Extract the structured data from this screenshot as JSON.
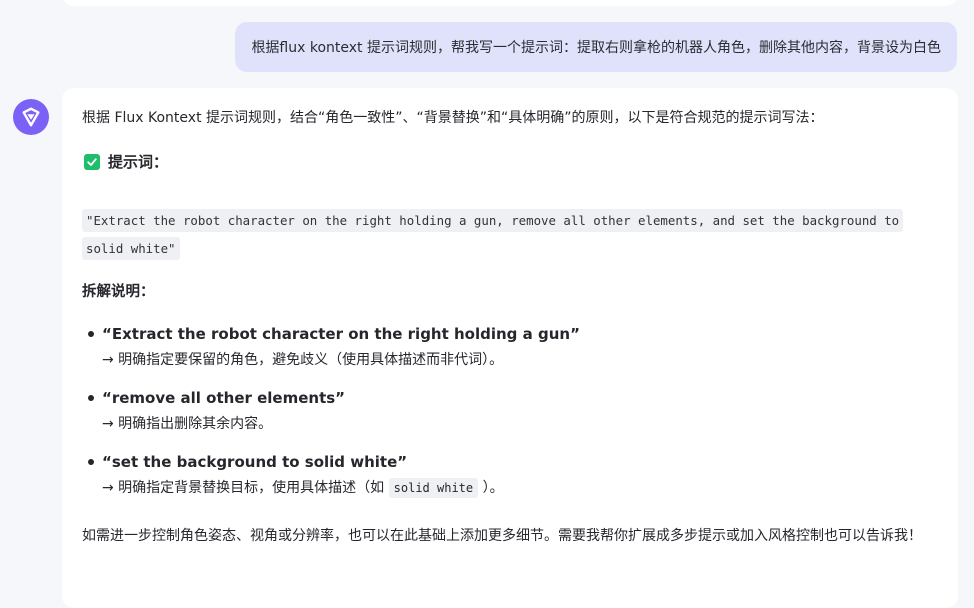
{
  "user_message": {
    "text": "根据flux kontext 提示词规则，帮我写一个提示词：提取右则拿枪的机器人角色，删除其他内容，背景设为白色"
  },
  "assistant": {
    "avatar_icon": "assistant-logo-icon",
    "intro": "根据 Flux Kontext 提示词规则，结合“角色一致性”、“背景替换”和“具体明确”的原则，以下是符合规范的提示词写法：",
    "prompt_heading": "提示词：",
    "prompt_code": "\"Extract the robot character on the right holding a gun, remove all other elements, and set the background to solid white\"",
    "breakdown_heading": "拆解说明：",
    "items": [
      {
        "title": "“Extract the robot character on the right holding a gun”",
        "desc": "→ 明确指定要保留的角色，避免歧义（使用具体描述而非代词）。"
      },
      {
        "title": "“remove all other elements”",
        "desc": "→ 明确指出删除其余内容。"
      },
      {
        "title": "“set the background to solid white”",
        "desc_prefix": "→ 明确指定背景替换目标，使用具体描述（如 ",
        "desc_code": "solid white",
        "desc_suffix": " ）。"
      }
    ],
    "outro": "如需进一步控制角色姿态、视角或分辨率，也可以在此基础上添加更多细节。需要我帮你扩展成多步提示或加入风格控制也可以告诉我！"
  },
  "colors": {
    "page_bg": "#f6f7fb",
    "user_bubble": "#e0e2fb",
    "avatar": "#7b61f5",
    "check": "#1fbe6a",
    "code_bg": "#eef0f3"
  }
}
